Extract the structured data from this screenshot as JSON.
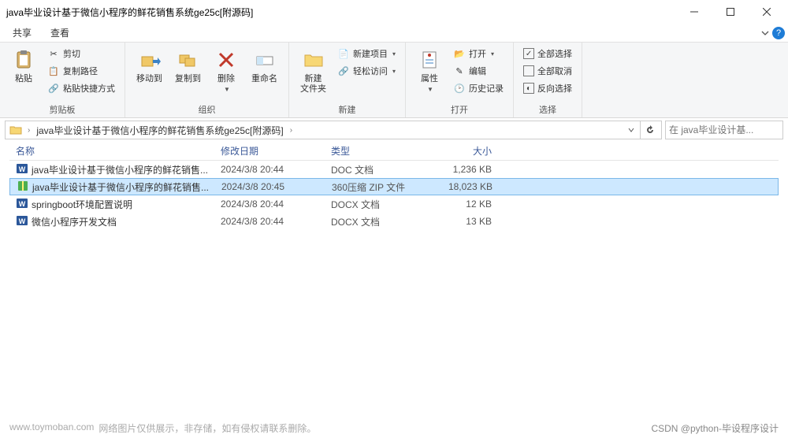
{
  "window": {
    "title": "java毕业设计基于微信小程序的鲜花销售系统ge25c[附源码]"
  },
  "tabs": {
    "share": "共享",
    "view": "查看"
  },
  "ribbon": {
    "clipboard": {
      "label": "剪贴板",
      "paste": "粘贴",
      "cut": "剪切",
      "copy_path": "复制路径",
      "paste_shortcut": "粘贴快捷方式"
    },
    "organize": {
      "label": "组织",
      "move_to": "移动到",
      "copy_to": "复制到",
      "delete": "删除",
      "rename": "重命名"
    },
    "new": {
      "label": "新建",
      "new_folder": "新建\n文件夹",
      "new_project": "新建项目",
      "easy_access": "轻松访问"
    },
    "open": {
      "label": "打开",
      "properties": "属性",
      "open_btn": "打开",
      "edit": "编辑",
      "history": "历史记录"
    },
    "select": {
      "label": "选择",
      "select_all": "全部选择",
      "select_none": "全部取消",
      "invert": "反向选择"
    }
  },
  "breadcrumb": {
    "path": "java毕业设计基于微信小程序的鲜花销售系统ge25c[附源码]"
  },
  "search": {
    "placeholder": "在 java毕业设计基..."
  },
  "columns": {
    "name": "名称",
    "date": "修改日期",
    "type": "类型",
    "size": "大小"
  },
  "files": [
    {
      "icon": "word",
      "name": "java毕业设计基于微信小程序的鲜花销售...",
      "date": "2024/3/8 20:44",
      "type": "DOC 文档",
      "size": "1,236 KB",
      "selected": false
    },
    {
      "icon": "zip",
      "name": "java毕业设计基于微信小程序的鲜花销售...",
      "date": "2024/3/8 20:45",
      "type": "360压缩 ZIP 文件",
      "size": "18,023 KB",
      "selected": true
    },
    {
      "icon": "word",
      "name": "springboot环境配置说明",
      "date": "2024/3/8 20:44",
      "type": "DOCX 文档",
      "size": "12 KB",
      "selected": false
    },
    {
      "icon": "word",
      "name": "微信小程序开发文档",
      "date": "2024/3/8 20:44",
      "type": "DOCX 文档",
      "size": "13 KB",
      "selected": false
    }
  ],
  "footer": {
    "site": "www.toymoban.com",
    "note": "网络图片仅供展示，非存储，如有侵权请联系删除。",
    "credit": "CSDN @python-毕设程序设计"
  }
}
